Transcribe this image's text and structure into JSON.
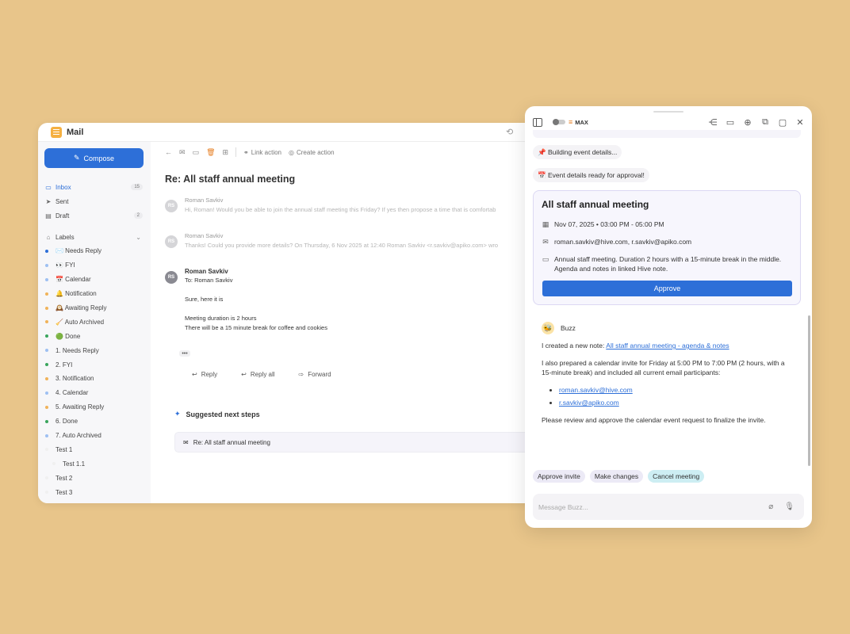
{
  "mail": {
    "title": "Mail",
    "compose_label": "Compose",
    "nav": [
      {
        "icon": "inbox-icon",
        "label": "Inbox",
        "count": "15",
        "active": true
      },
      {
        "icon": "send-icon",
        "label": "Sent",
        "count": ""
      },
      {
        "icon": "draft-icon",
        "label": "Draft",
        "count": "2"
      }
    ],
    "labels_heading": "Labels",
    "labels": [
      {
        "text": "✉️ Needs Reply",
        "color": "#2d6fd8",
        "sub": false
      },
      {
        "text": "👀 FYI",
        "color": "#9ec0f2",
        "sub": false
      },
      {
        "text": "📅 Calendar",
        "color": "#9ec0f2",
        "sub": false
      },
      {
        "text": "🔔 Notification",
        "color": "#f0b35a",
        "sub": false
      },
      {
        "text": "🕰️ Awaiting Reply",
        "color": "#f0b35a",
        "sub": false
      },
      {
        "text": "🧹 Auto Archived",
        "color": "#f0b35a",
        "sub": false
      },
      {
        "text": "🟢 Done",
        "color": "#3aa55c",
        "sub": false
      },
      {
        "text": "1. Needs Reply",
        "color": "#9ec0f2",
        "sub": false
      },
      {
        "text": "2. FYI",
        "color": "#3aa55c",
        "sub": false
      },
      {
        "text": "3. Notification",
        "color": "#f0b35a",
        "sub": false
      },
      {
        "text": "4. Calendar",
        "color": "#9ec0f2",
        "sub": false
      },
      {
        "text": "5. Awaiting Reply",
        "color": "#f0b35a",
        "sub": false
      },
      {
        "text": "6. Done",
        "color": "#3aa55c",
        "sub": false
      },
      {
        "text": "7. Auto Archived",
        "color": "#9ec0f2",
        "sub": false
      },
      {
        "text": "Test 1",
        "color": "#f0f0f0",
        "sub": false
      },
      {
        "text": "Test 1.1",
        "color": "#f0f0f0",
        "sub": true
      },
      {
        "text": "Test 2",
        "color": "#f0f0f0",
        "sub": false
      },
      {
        "text": "Test 3",
        "color": "#f0f0f0",
        "sub": false
      }
    ],
    "toolbar": {
      "link_action": "Link action",
      "create_action": "Create action"
    },
    "subject": "Re: All staff annual meeting",
    "messages": [
      {
        "initials": "RS",
        "from": "Roman Savkiv",
        "preview": "Hi, Roman! Would you be able to join the annual staff meeting this Friday? If yes then propose a time that is comfortab"
      },
      {
        "initials": "RS",
        "from": "Roman Savkiv",
        "preview": "Thanks! Could you provide more details? On Thursday, 6 Nov 2025 at 12:40 Roman Savkiv <r.savkiv@apiko.com> wro"
      }
    ],
    "open_message": {
      "initials": "RS",
      "from": "Roman Savkiv",
      "to": "To: Roman Savkiv",
      "line1": "Sure, here it is",
      "line2": "Meeting duration is 2 hours",
      "line3": "There will be a 15 minute break for coffee and cookies"
    },
    "more_label": "•••",
    "reply_label": "Reply",
    "reply_all_label": "Reply all",
    "forward_label": "Forward",
    "suggested_heading": "Suggested next steps",
    "suggested_item": "Re: All staff annual meeting"
  },
  "buzz": {
    "mode_label": "MAX",
    "status_chips": [
      "📌 Building event details...",
      "📅 Event details ready for approval!"
    ],
    "event": {
      "title": "All staff annual meeting",
      "datetime": "Nov 07, 2025 • 03:00 PM - 05:00 PM",
      "attendees": "roman.savkiv@hive.com, r.savkiv@apiko.com",
      "description": "Annual staff meeting. Duration 2 hours with a 15-minute break in the middle. Agenda and notes in linked Hive note.",
      "approve_label": "Approve"
    },
    "assistant_name": "Buzz",
    "note_prefix": "I created a new note: ",
    "note_link": "All staff annual meeting - agenda & notes",
    "invite_text": "I also prepared a calendar invite for Friday at 5:00 PM to 7:00 PM (2 hours, with a 15-minute break) and included all current email participants:",
    "participants": [
      "roman.savkiv@hive.com",
      "r.savkiv@apiko.com"
    ],
    "closing_text": "Please review and approve the calendar event request to finalize the invite.",
    "quick_actions": [
      "Approve invite",
      "Make changes",
      "Cancel meeting"
    ],
    "input_placeholder": "Message Buzz..."
  }
}
